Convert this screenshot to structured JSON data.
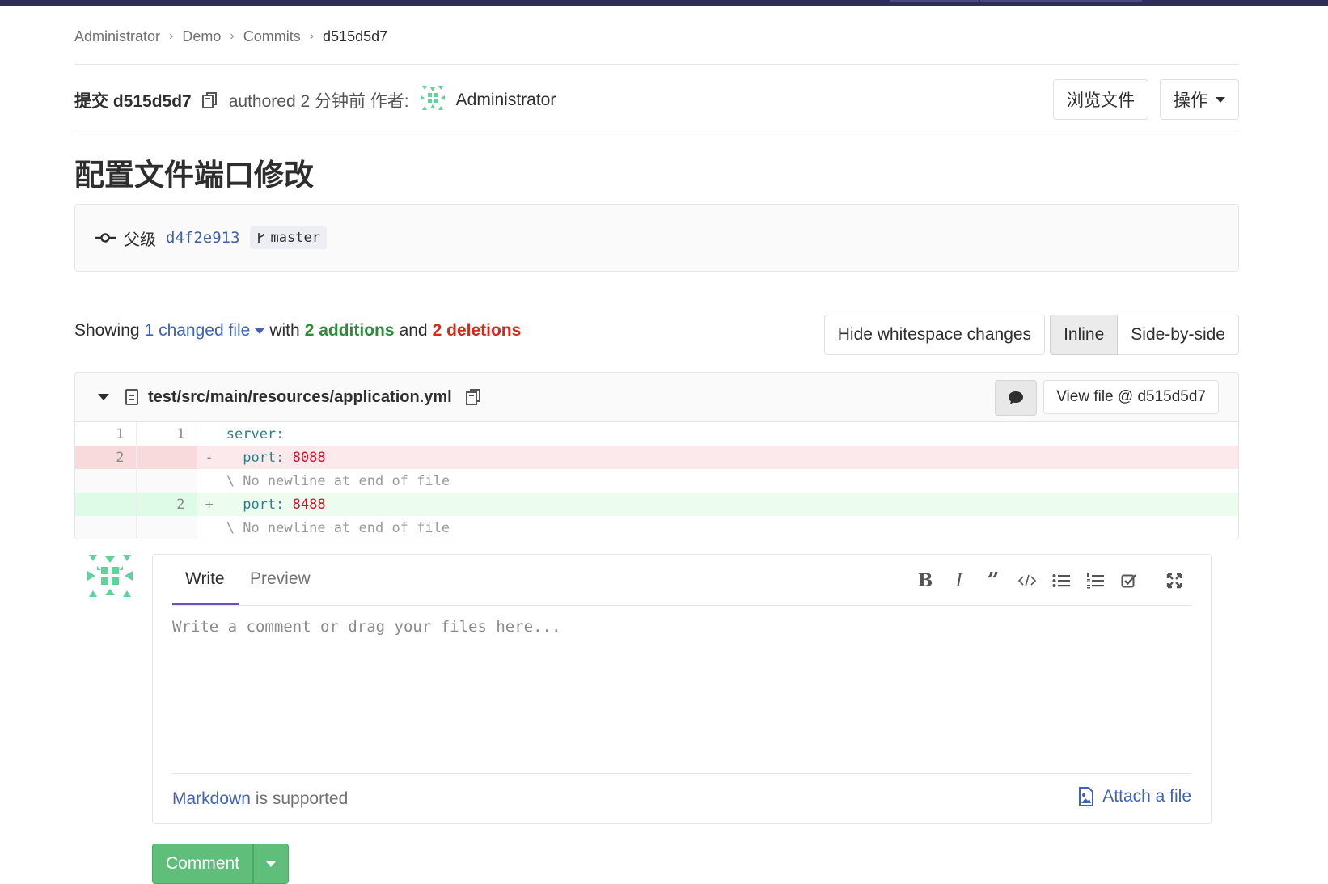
{
  "breadcrumb": {
    "items": [
      "Administrator",
      "Demo",
      "Commits",
      "d515d5d7"
    ]
  },
  "commit": {
    "label": "提交 d515d5d7",
    "authored": "authored 2 分钟前 作者:",
    "author": "Administrator",
    "browse_button": "浏览文件",
    "actions_button": "操作",
    "title": "配置文件端口修改",
    "parent_label": "父级",
    "parent_sha": "d4f2e913",
    "branch": "master"
  },
  "stats": {
    "showing": "Showing",
    "changed_files": "1 changed file",
    "with": "with",
    "additions": "2 additions",
    "and": "and",
    "deletions": "2 deletions"
  },
  "view_controls": {
    "hide_whitespace": "Hide whitespace changes",
    "inline": "Inline",
    "side_by_side": "Side-by-side",
    "active": "Inline"
  },
  "diff": {
    "file_path": "test/src/main/resources/application.yml",
    "view_file_button": "View file @ d515d5d7",
    "lines": [
      {
        "type": "context",
        "old": "1",
        "new": "1",
        "sign": " ",
        "key": "server:",
        "value": ""
      },
      {
        "type": "del",
        "old": "2",
        "new": "",
        "sign": "-",
        "key": "  port:",
        "value": " 8088"
      },
      {
        "type": "meta",
        "old": "",
        "new": "",
        "sign": " ",
        "key": "\\ No newline at end of file",
        "value": ""
      },
      {
        "type": "add",
        "old": "",
        "new": "2",
        "sign": "+",
        "key": "  port:",
        "value": " 8488"
      },
      {
        "type": "meta",
        "old": "",
        "new": "",
        "sign": " ",
        "key": "\\ No newline at end of file",
        "value": ""
      }
    ]
  },
  "comment_form": {
    "tab_write": "Write",
    "tab_preview": "Preview",
    "placeholder": "Write a comment or drag your files here...",
    "markdown_link": "Markdown",
    "markdown_text": "is supported",
    "attach": "Attach a file",
    "submit": "Comment",
    "toolbar_icons": [
      "bold-icon",
      "italic-icon",
      "quote-icon",
      "code-icon",
      "bullet-list-icon",
      "numbered-list-icon",
      "task-list-icon",
      "fullscreen-icon"
    ]
  },
  "colors": {
    "accent_purple": "#6b4fbb",
    "link_blue": "#3f62b5",
    "addition_green": "#2f8a3d",
    "deletion_red": "#cf2c1d",
    "comment_button": "#5fbf7a",
    "avatar_green": "#5fd39a"
  }
}
